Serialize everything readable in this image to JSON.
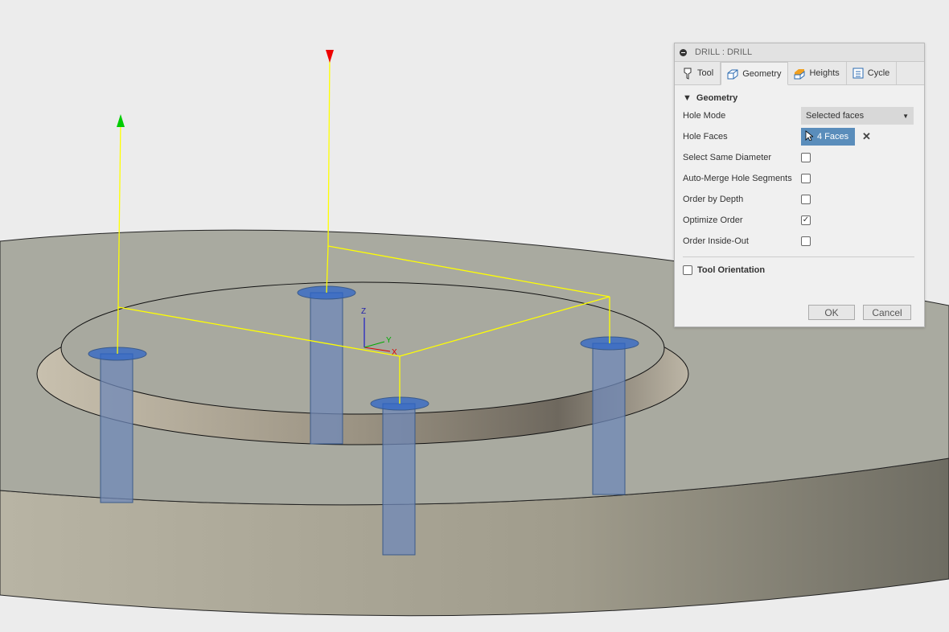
{
  "viewport": {
    "axis_labels": {
      "z": "Z",
      "y": "Y",
      "x": "X"
    }
  },
  "dialog": {
    "title": "DRILL : DRILL",
    "tabs": [
      {
        "label": "Tool",
        "icon": "tool-icon"
      },
      {
        "label": "Geometry",
        "icon": "geometry-icon",
        "active": true
      },
      {
        "label": "Heights",
        "icon": "heights-icon"
      },
      {
        "label": "Cycle",
        "icon": "cycle-icon"
      }
    ],
    "section": "Geometry",
    "hole_mode": {
      "label": "Hole Mode",
      "value": "Selected faces"
    },
    "hole_faces": {
      "label": "Hole Faces",
      "value": "4 Faces"
    },
    "options": [
      {
        "label": "Select Same Diameter",
        "checked": false
      },
      {
        "label": "Auto-Merge Hole Segments",
        "checked": false
      },
      {
        "label": "Order by Depth",
        "checked": false
      },
      {
        "label": "Optimize Order",
        "checked": true
      },
      {
        "label": "Order Inside-Out",
        "checked": false
      }
    ],
    "tool_orientation": {
      "label": "Tool Orientation",
      "checked": false
    },
    "ok": "OK",
    "cancel": "Cancel",
    "colors": {
      "accent": "#5a8dbb",
      "toolpath": "#ffff00"
    }
  }
}
